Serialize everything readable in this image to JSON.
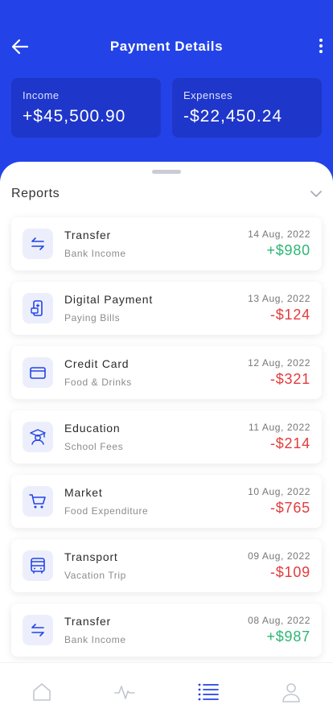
{
  "header": {
    "title": "Payment Details"
  },
  "summary": [
    {
      "label": "Income",
      "value": "+$45,500.90"
    },
    {
      "label": "Expenses",
      "value": "-$22,450.24"
    }
  ],
  "reports": {
    "title": "Reports"
  },
  "transactions": [
    {
      "name": "Transfer",
      "sub": "Bank Income",
      "date": "14 Aug, 2022",
      "amount": "+$980",
      "icon": "transfer-icon",
      "type": "income"
    },
    {
      "name": "Digital Payment",
      "sub": "Paying Bills",
      "date": "13 Aug, 2022",
      "amount": "-$124",
      "icon": "digital-payment-icon",
      "type": "expense"
    },
    {
      "name": "Credit Card",
      "sub": "Food & Drinks",
      "date": "12 Aug, 2022",
      "amount": "-$321",
      "icon": "credit-card-icon",
      "type": "expense"
    },
    {
      "name": "Education",
      "sub": "School Fees",
      "date": "11 Aug, 2022",
      "amount": "-$214",
      "icon": "graduate-icon",
      "type": "expense"
    },
    {
      "name": "Market",
      "sub": "Food Expenditure",
      "date": "10 Aug, 2022",
      "amount": "-$765",
      "icon": "cart-icon",
      "type": "expense"
    },
    {
      "name": "Transport",
      "sub": "Vacation Trip",
      "date": "09 Aug, 2022",
      "amount": "-$109",
      "icon": "bus-icon",
      "type": "expense"
    },
    {
      "name": "Transfer",
      "sub": "Bank Income",
      "date": "08 Aug, 2022",
      "amount": "+$987",
      "icon": "transfer-icon",
      "type": "income"
    }
  ],
  "tabs": [
    {
      "icon": "home-icon",
      "active": false
    },
    {
      "icon": "activity-icon",
      "active": false
    },
    {
      "icon": "list-icon",
      "active": true
    },
    {
      "icon": "profile-icon",
      "active": false
    }
  ],
  "colors": {
    "primary": "#2343e8",
    "income": "#2bb673",
    "expense": "#e23b3b",
    "icon": "#2343e8"
  }
}
